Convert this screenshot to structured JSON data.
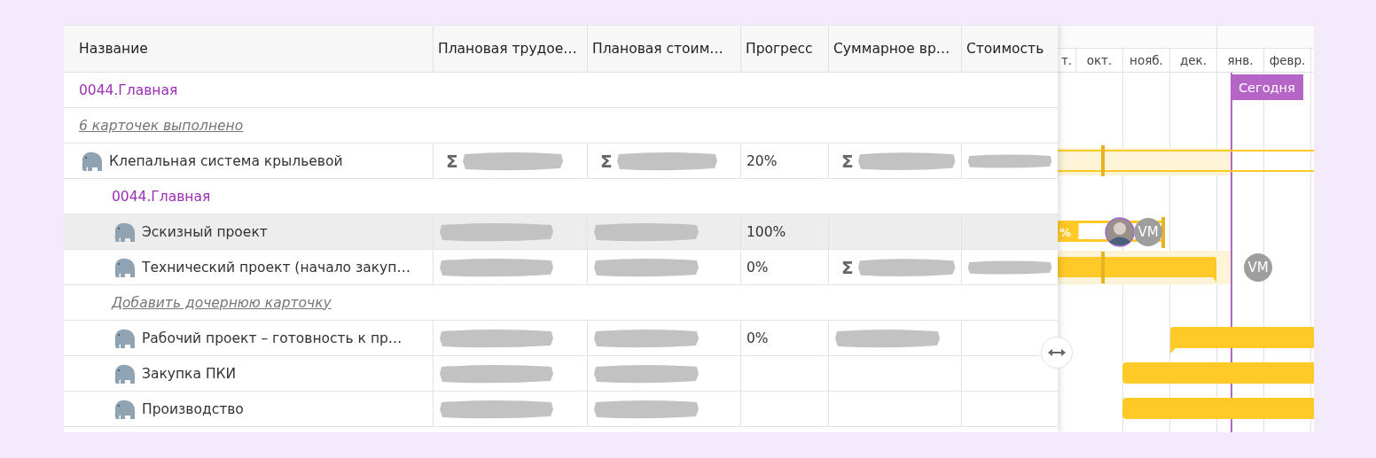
{
  "columns": [
    "Название",
    "Плановая трудое…",
    "Плановая стоим…",
    "Прогресс",
    "Суммарное вр…",
    "Стоимость"
  ],
  "gantt": {
    "months": [
      "т.",
      "окт.",
      "нояб.",
      "дек.",
      "янв.",
      "февр."
    ],
    "today": "Сегодня"
  },
  "rows": [
    {
      "kind": "group",
      "label": "0044.Главная"
    },
    {
      "kind": "link",
      "label": "6 карточек выполнено"
    },
    {
      "kind": "card",
      "name": "Клепальная система крыльевой",
      "selected": false,
      "timeline": {
        "kind": "summary"
      },
      "cells": [
        {
          "sigma": "Σ",
          "redacted": true
        },
        {
          "sigma": "Σ",
          "redacted": true
        },
        {
          "text": "20%"
        },
        {
          "sigma": "Σ",
          "redacted": true
        },
        {
          "redacted": true
        }
      ],
      "children": [
        {
          "kind": "group",
          "label": "0044.Главная"
        },
        {
          "kind": "card",
          "name": "Эскизный проект",
          "selected": true,
          "timeline": {
            "kind": "progress",
            "label": "%"
          },
          "assignees": [
            {
              "kind": "photo"
            },
            {
              "kind": "initials",
              "text": "VM"
            }
          ],
          "cells": [
            {
              "redacted": true
            },
            {
              "redacted": true
            },
            {
              "text": "100%"
            },
            {
              "redacted": false
            },
            {
              "redacted": false
            }
          ]
        },
        {
          "kind": "card",
          "name": "Технический проект (начало закуп…",
          "selected": false,
          "timeline": {
            "kind": "task"
          },
          "assignees": [
            {
              "kind": "initials",
              "text": "VM"
            }
          ],
          "cells": [
            {
              "redacted": true
            },
            {
              "redacted": true
            },
            {
              "text": "0%"
            },
            {
              "sigma": "Σ",
              "redacted": true
            },
            {
              "redacted": true
            }
          ]
        },
        {
          "kind": "link",
          "label": "Добавить дочернюю карточку"
        },
        {
          "kind": "card",
          "name": "Рабочий проект – готовность к пр…",
          "selected": false,
          "timeline": {
            "kind": "task-flag"
          },
          "cells": [
            {
              "redacted": true
            },
            {
              "redacted": true
            },
            {
              "text": "0%"
            },
            {
              "redacted": true
            },
            {
              "redacted": false
            }
          ]
        },
        {
          "kind": "card",
          "name": "Закупка ПКИ",
          "selected": false,
          "timeline": {
            "kind": "task-long"
          },
          "cells": [
            {
              "redacted": true
            },
            {
              "redacted": true
            },
            {
              "redacted": false
            },
            {
              "redacted": false
            },
            {
              "redacted": false
            }
          ]
        },
        {
          "kind": "card",
          "name": "Производство",
          "selected": false,
          "timeline": {
            "kind": "task-long"
          },
          "cells": [
            {
              "redacted": true
            },
            {
              "redacted": true
            },
            {
              "redacted": false
            },
            {
              "redacted": false
            },
            {
              "redacted": false
            }
          ]
        }
      ]
    }
  ]
}
